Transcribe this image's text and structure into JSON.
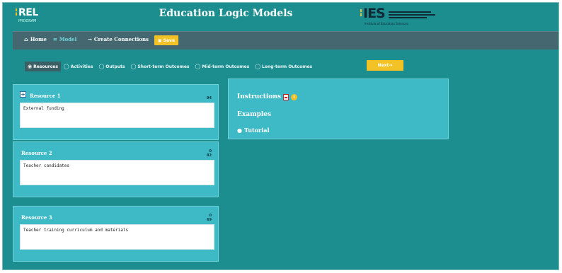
{
  "header": {
    "logo_left_text": "REL",
    "logo_left_sub": "PROGRAM",
    "title": "Education Logic Models",
    "logo_right_text": "IES",
    "logo_right_tagline": "Institute of Education Sciences"
  },
  "nav": {
    "items": [
      {
        "label": "Home",
        "icon": "home-icon"
      },
      {
        "label": "Model",
        "icon": "model-icon"
      },
      {
        "label": "Create Connections",
        "icon": "connections-icon"
      }
    ],
    "save_label": "Save"
  },
  "tabs": {
    "items": [
      "Resources",
      "Activities",
      "Outputs",
      "Short-term Outcomes",
      "Mid-term Outcomes",
      "Long-term Outcomes"
    ],
    "active": "Resources",
    "next_label": "Next"
  },
  "resources": [
    {
      "title": "Resource 1",
      "value": "External funding",
      "count": "94"
    },
    {
      "title": "Resource 2",
      "value": "Teacher candidates",
      "count_top": "0",
      "count": "82"
    },
    {
      "title": "Resource 3",
      "value": "Teacher training curriculum and materials",
      "count_top": "0",
      "count": "69"
    }
  ],
  "instructions": {
    "label": "Instructions",
    "examples_label": "Examples",
    "tutorial_label": "Tutorial"
  },
  "colors": {
    "background": "#1c8e90",
    "card": "#3ebac7",
    "nav": "#456870",
    "accent": "#f2c227"
  }
}
